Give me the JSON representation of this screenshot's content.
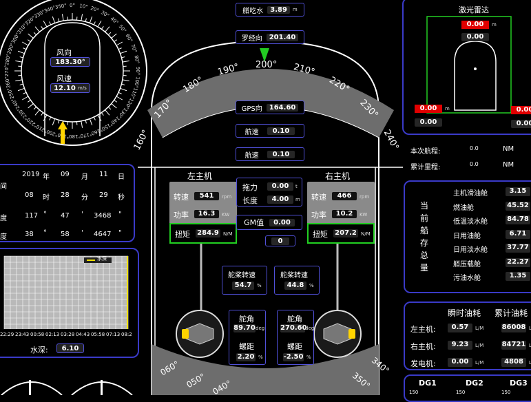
{
  "compass_panel": {
    "wind_dir_label": "风向",
    "wind_dir_value": "183.30°",
    "wind_speed_label": "风速",
    "wind_speed_value": "12.10",
    "wind_speed_unit": "m/s",
    "ticks": [
      "340°",
      "350°",
      "0°",
      "10°",
      "20°",
      "30°",
      "40°",
      "50°",
      "60°",
      "70°",
      "80°",
      "90°",
      "100°",
      "110°",
      "120°",
      "130°",
      "140°",
      "150°",
      "160°",
      "170°",
      "180°",
      "190°",
      "200°",
      "210°",
      "220°",
      "230°",
      "240°",
      "250°",
      "260°",
      "270°",
      "280°",
      "290°",
      "300°",
      "310°",
      "320°",
      "330°"
    ]
  },
  "datetime_panel": {
    "row1": {
      "label": "间",
      "year": "2019",
      "year_u": "年",
      "month": "09",
      "month_u": "月",
      "day": "11",
      "day_u": "日"
    },
    "row2": {
      "hour": "08",
      "hour_u": "时",
      "min": "28",
      "min_u": "分",
      "sec": "29",
      "sec_u": "秒"
    },
    "row3": {
      "label": "度",
      "a": "117",
      "a_u": "°",
      "b": "47",
      "b_u": "'",
      "c": "3468",
      "c_u": "\""
    },
    "row4": {
      "label": "度",
      "a": "38",
      "a_u": "°",
      "b": "58",
      "b_u": "'",
      "c": "4647",
      "c_u": "\""
    }
  },
  "depth_panel": {
    "legend": "水深",
    "x_ticks": [
      "22:29",
      "23:43",
      "00:58",
      "02:13",
      "03:28",
      "04:43",
      "05:58",
      "07:13",
      "08:2"
    ],
    "depth_label": "水深:",
    "depth_value": "6.10"
  },
  "center": {
    "draft_label": "艏吃水",
    "draft_value": "3.89",
    "draft_unit": "m",
    "heading_label": "罗经向",
    "heading_value": "201.40",
    "heading_ticks": [
      "160°",
      "170°",
      "180°",
      "190°",
      "200°",
      "210°",
      "220°",
      "230°",
      "240°"
    ],
    "gps_label": "GPS向",
    "gps_value": "164.60",
    "speed1_label": "航速",
    "speed1_value": "0.10",
    "speed2_label": "航速",
    "speed2_value": "0.10",
    "bottom_ticks": [
      "060°",
      "050°",
      "040°",
      "350°",
      "340°"
    ]
  },
  "left_engine": {
    "title": "左主机",
    "speed_label": "转速",
    "speed_value": "541",
    "speed_unit": "rpm",
    "power_label": "功率",
    "power_value": "16.3",
    "power_unit": "KW",
    "torque_label": "扭矩",
    "torque_value": "284.9",
    "torque_unit": "N/M"
  },
  "right_engine": {
    "title": "右主机",
    "speed_label": "转速",
    "speed_value": "466",
    "speed_unit": "rpm",
    "power_label": "功率",
    "power_value": "10.2",
    "power_unit": "KW",
    "torque_label": "扭矩",
    "torque_value": "207.2",
    "torque_unit": "N/M"
  },
  "tow": {
    "force_label": "拖力",
    "force_value": "0.00",
    "force_unit": "t",
    "length_label": "长度",
    "length_value": "4.00",
    "length_unit": "m",
    "gm_label": "GM值",
    "gm_value": "0.00",
    "extra_value": "0"
  },
  "rudder_left": {
    "speed_label": "舵桨转速",
    "speed_value": "54.7",
    "speed_unit": "%",
    "angle_label": "舵角",
    "angle_value": "89.70",
    "angle_unit": "deg",
    "pitch_label": "螺距",
    "pitch_value": "2.20",
    "pitch_unit": "%"
  },
  "rudder_right": {
    "speed_label": "舵桨转速",
    "speed_value": "44.8",
    "speed_unit": "%",
    "angle_label": "舵角",
    "angle_value": "270.60",
    "angle_unit": "deg",
    "pitch_label": "螺距",
    "pitch_value": "-2.50",
    "pitch_unit": "%"
  },
  "radar": {
    "title": "激光雷达",
    "top_red": "0.00",
    "top_unit": "m",
    "top_gray": "0.00",
    "left_red": "0.00",
    "left_unit": "m",
    "left_gray": "0.00",
    "right_red": "0.00",
    "right_gray": "0.00"
  },
  "voyage": {
    "this_label": "本次航程:",
    "this_value": "0.0",
    "this_unit": "NM",
    "total_label": "累计里程:",
    "total_value": "0.0",
    "total_unit": "NM"
  },
  "storage": {
    "side_label": "当前船存总量",
    "items": [
      {
        "label": "主机滑油舱",
        "value": "3.15"
      },
      {
        "label": "燃油舱",
        "value": "45.52"
      },
      {
        "label": "低温淡水舱",
        "value": "84.78"
      },
      {
        "label": "日用油舱",
        "value": "6.71"
      },
      {
        "label": "日用淡水舱",
        "value": "37.77"
      },
      {
        "label": "艏压载舱",
        "value": "22.27"
      },
      {
        "label": "污油水舱",
        "value": "1.35"
      }
    ]
  },
  "fuel": {
    "instant_header": "瞬时油耗",
    "total_header": "累计油耗",
    "rows": [
      {
        "label": "左主机:",
        "instant": "0.57",
        "instant_u": "L/M",
        "total": "86008",
        "total_u": "L"
      },
      {
        "label": "右主机:",
        "instant": "9.23",
        "instant_u": "L/M",
        "total": "84721",
        "total_u": "L"
      },
      {
        "label": "发电机:",
        "instant": "0.00",
        "instant_u": "L/M",
        "total": "4808",
        "total_u": "L"
      }
    ]
  },
  "dg": {
    "labels": [
      "DG1",
      "DG2",
      "DG3"
    ],
    "scale": "150"
  }
}
